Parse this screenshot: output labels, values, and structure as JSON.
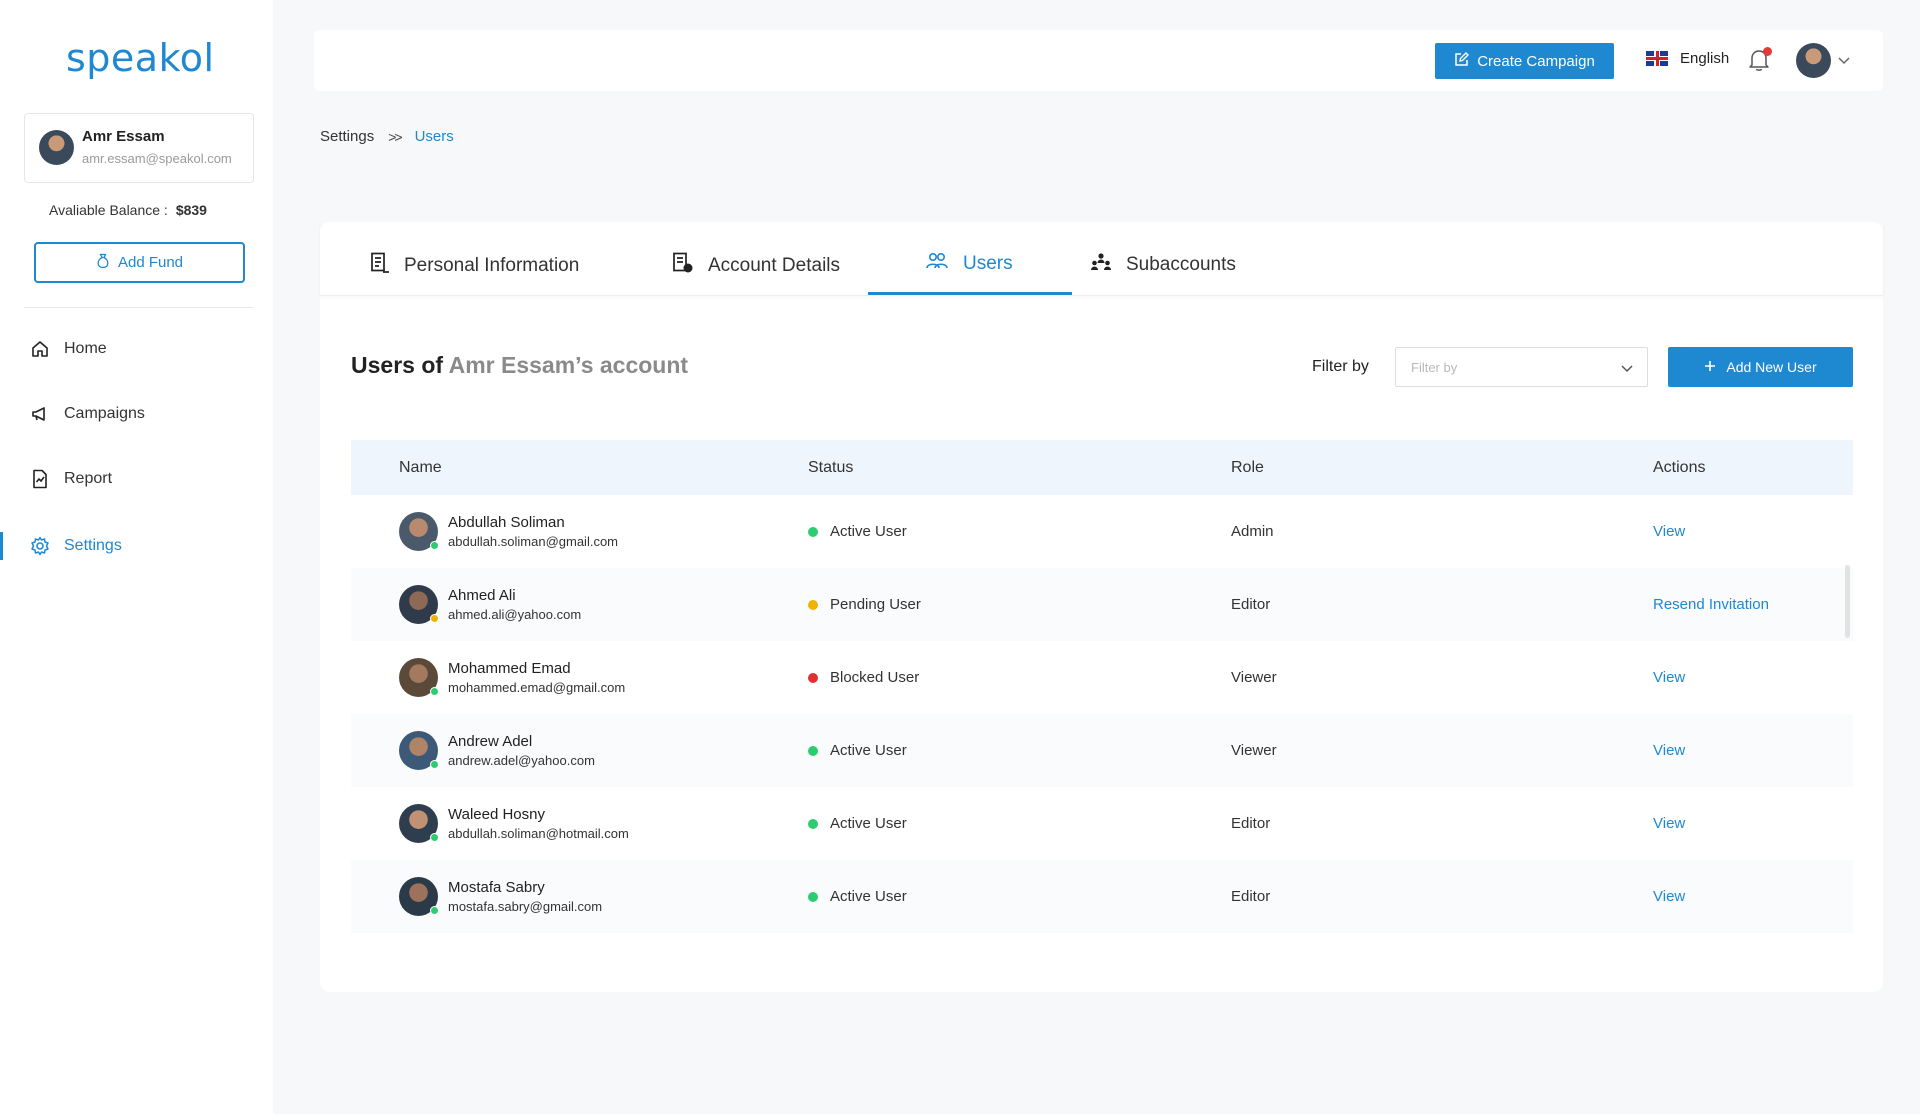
{
  "brand": {
    "logo_text": "speakol",
    "accent": "#1e88d1"
  },
  "profile": {
    "name": "Amr Essam",
    "email": "amr.essam@speakol.com"
  },
  "balance": {
    "label": "Avaliable Balance :",
    "amount": "$839"
  },
  "add_fund_label": "Add Fund",
  "nav": {
    "items": [
      {
        "label": "Home",
        "icon": "home-icon"
      },
      {
        "label": "Campaigns",
        "icon": "megaphone-icon"
      },
      {
        "label": "Report",
        "icon": "report-icon"
      },
      {
        "label": "Settings",
        "icon": "gear-icon",
        "active": true
      }
    ]
  },
  "topbar": {
    "create_label": "Create Campaign",
    "language": "English"
  },
  "breadcrumb": {
    "root": "Settings",
    "separator": ">>",
    "current": "Users"
  },
  "tabs": [
    {
      "label": "Personal Information",
      "icon": "personal-info-icon"
    },
    {
      "label": "Account Details",
      "icon": "account-details-icon"
    },
    {
      "label": "Users",
      "icon": "users-icon",
      "active": true
    },
    {
      "label": "Subaccounts",
      "icon": "subaccounts-icon"
    }
  ],
  "users_section": {
    "title_prefix": "Users of",
    "title_account": "Amr Essam’s account",
    "filter_label": "Filter by",
    "filter_placeholder": "Filter by",
    "add_user_label": "Add New User"
  },
  "table": {
    "headers": {
      "name": "Name",
      "status": "Status",
      "role": "Role",
      "actions": "Actions"
    },
    "rows": [
      {
        "name": "Abdullah Soliman",
        "email": "abdullah.soliman@gmail.com",
        "status": "Active User",
        "status_color": "#2ecc71",
        "role": "Admin",
        "action": "View",
        "presence": "#2ecc71"
      },
      {
        "name": "Ahmed Ali",
        "email": "ahmed.ali@yahoo.com",
        "status": "Pending User",
        "status_color": "#f0b400",
        "role": "Editor",
        "action": "Resend Invitation",
        "presence": "#f0b400"
      },
      {
        "name": "Mohammed Emad",
        "email": "mohammed.emad@gmail.com",
        "status": "Blocked User",
        "status_color": "#e03131",
        "role": "Viewer",
        "action": "View",
        "presence": "#2ecc71"
      },
      {
        "name": "Andrew Adel",
        "email": "andrew.adel@yahoo.com",
        "status": "Active User",
        "status_color": "#2ecc71",
        "role": "Viewer",
        "action": "View",
        "presence": "#2ecc71"
      },
      {
        "name": "Waleed Hosny",
        "email": "abdullah.soliman@hotmail.com",
        "status": "Active User",
        "status_color": "#2ecc71",
        "role": "Editor",
        "action": "View",
        "presence": "#2ecc71"
      },
      {
        "name": "Mostafa Sabry",
        "email": "mostafa.sabry@gmail.com",
        "status": "Active User",
        "status_color": "#2ecc71",
        "role": "Editor",
        "action": "View",
        "presence": "#2ecc71"
      }
    ]
  }
}
